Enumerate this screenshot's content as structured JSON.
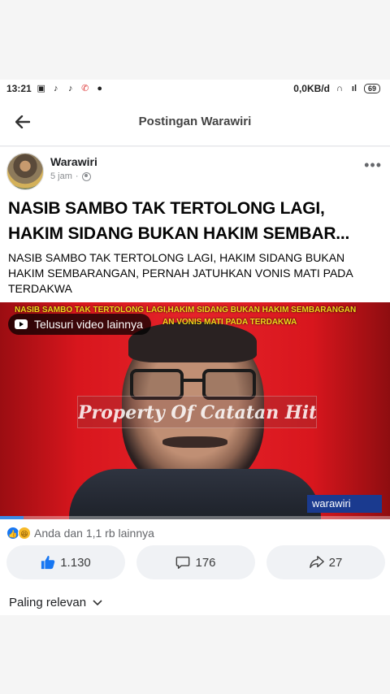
{
  "status_bar": {
    "time": "13:21",
    "net_speed": "0,0KB/d",
    "battery": "69"
  },
  "header": {
    "title": "Postingan Warawiri"
  },
  "post": {
    "author": "Warawiri",
    "time": "5 jam",
    "separator": "·",
    "headline": "NASIB SAMBO TAK TERTOLONG LAGI, HAKIM SIDANG BUKAN HAKIM SEMBAR...",
    "description": "NASIB SAMBO TAK TERTOLONG LAGI, HAKIM SIDANG BUKAN HAKIM SEMBARANGAN, PERNAH JATUHKAN VONIS MATI PADA TERDAKWA",
    "video": {
      "top_text_line1": "NASIB SAMBO TAK TERTOLONG LAGI,HAKIM SIDANG BUKAN HAKIM SEMBARANGAN",
      "top_text_line2": "AN VONIS MATI PADA TERDAKWA",
      "explore_label": "Telusuri video lainnya",
      "watermark": "Property Of Catatan Hitam",
      "channel_tag": "warawiri",
      "progress": 0.06
    },
    "reactions_text": "Anda dan 1,1 rb lainnya",
    "likes": "1.130",
    "comments": "176",
    "shares": "27",
    "sort_label": "Paling relevan"
  },
  "colors": {
    "accent": "#1877f2",
    "video_red": "#e5232a",
    "video_text": "#f3d71b"
  }
}
